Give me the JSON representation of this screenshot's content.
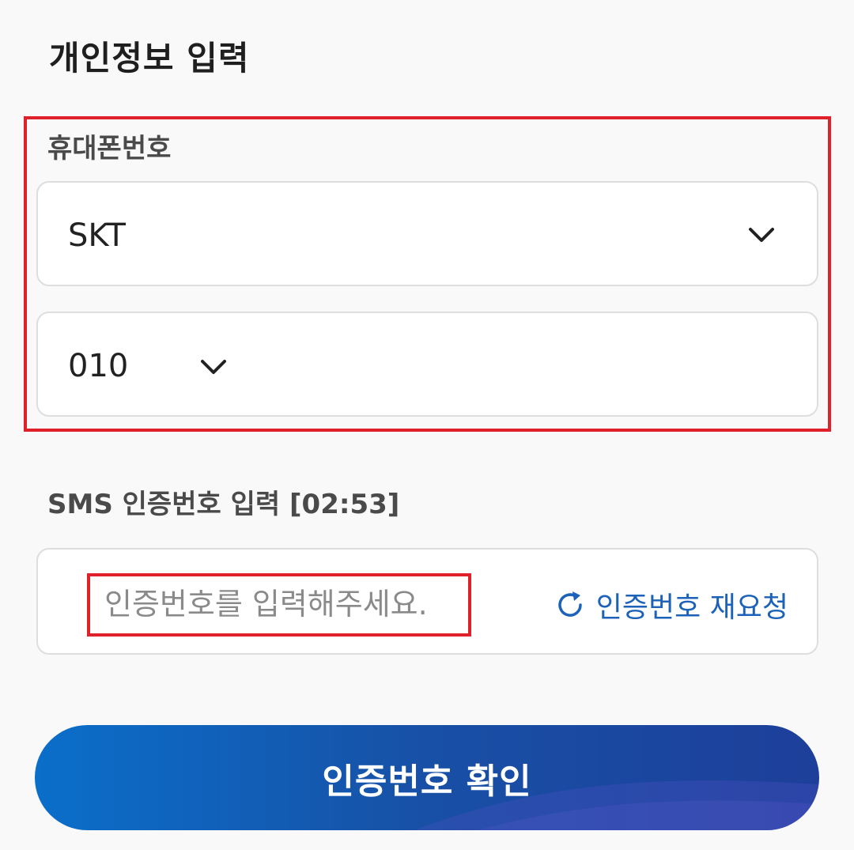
{
  "form": {
    "section_title": "개인정보 입력",
    "phone": {
      "label": "휴대폰번호",
      "carrier_value": "SKT",
      "prefix_value": "010"
    },
    "sms": {
      "label": "SMS 인증번호 입력 [02:53]",
      "code_placeholder": "인증번호를 입력해주세요.",
      "resend_label": "인증번호 재요청"
    },
    "confirm_button_label": "인증번호 확인"
  },
  "colors": {
    "highlight": "#e0202a",
    "link": "#1b62b8",
    "button_gradient_start": "#0a6fca",
    "button_gradient_end": "#1d3f9a"
  },
  "icons": {
    "dropdown": "chevron-down-icon",
    "resend": "refresh-icon"
  }
}
